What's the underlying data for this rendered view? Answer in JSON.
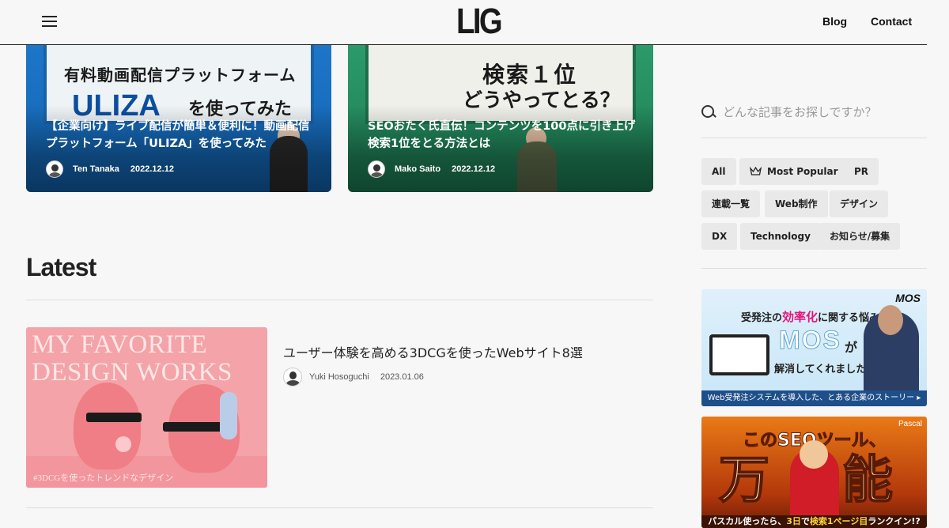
{
  "header": {
    "logo": "LIG",
    "nav": {
      "blog": "Blog",
      "contact": "Contact"
    }
  },
  "featured": [
    {
      "thumb_text_1": "有料動画配信プラットフォーム",
      "thumb_text_2": "ULIZA",
      "thumb_text_3": "を使ってみた",
      "title": "【企業向け】ライブ配信が簡単＆便利に！動画配信プラットフォーム「ULIZA」を使ってみた",
      "author": "Ten Tanaka",
      "date": "2022.12.12"
    },
    {
      "thumb_text_1": "検索１位",
      "thumb_text_2": "どうやってとる？",
      "title": "SEOおたく氏直伝！コンテンツを100点に引き上げ検索1位をとる方法とは",
      "author": "Mako Saito",
      "date": "2022.12.12"
    }
  ],
  "latest": {
    "heading": "Latest",
    "articles": [
      {
        "thumb_line_1": "MY FAVORITE",
        "thumb_line_2": "DESIGN WORKS",
        "thumb_tag": "#3DCGを使ったトレンドなデザイン",
        "title": "ユーザー体験を高める3DCGを使ったWebサイト8選",
        "author": "Yuki Hosoguchi",
        "date": "2023.01.06"
      }
    ]
  },
  "sidebar": {
    "search_placeholder": "どんな記事をお探しですか？",
    "tags": [
      "All",
      "Most Popular",
      "PR",
      "連載一覧",
      "Web制作",
      "デザイン",
      "DX",
      "Technology",
      "お知らせ/募集"
    ],
    "banner_mos": {
      "logo": "MOS",
      "line1_pre": "受発注の",
      "line1_hl": "効率化",
      "line1_post": "に関する悩み",
      "big": "MOS",
      "ga": "が",
      "line3": "解消してくれました",
      "footer": "Web受発注システムを導入した、とある企業のストーリー ▸"
    },
    "banner_seo": {
      "brand": "Pascal",
      "head": "このSEOツール、",
      "big1": "万",
      "big2": "能",
      "foot_pre": "パスカル使ったら、",
      "foot_hl": "3日",
      "foot_mid": "で",
      "foot_hl2": "検索1ページ目",
      "foot_post": "ランクイン!?"
    }
  },
  "colors": {
    "accent_pink": "#e4157c",
    "card1_bg": "#1e76c9",
    "card2_bg": "#2c9a6a",
    "thumb_pink": "#f4a3a8"
  }
}
